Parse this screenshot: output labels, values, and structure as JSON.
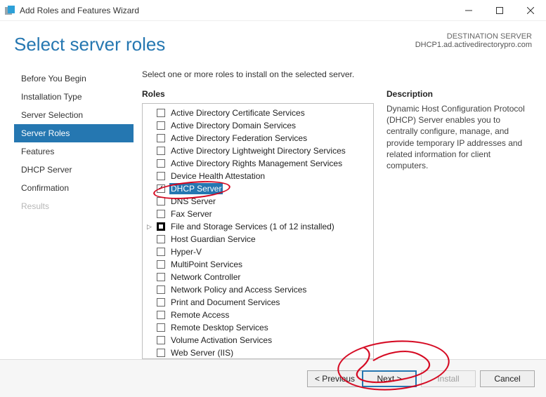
{
  "window": {
    "title": "Add Roles and Features Wizard"
  },
  "header": {
    "page_title": "Select server roles",
    "dest_label": "DESTINATION SERVER",
    "dest_value": "DHCP1.ad.activedirectorypro.com"
  },
  "steps": [
    {
      "label": "Before You Begin",
      "state": "normal"
    },
    {
      "label": "Installation Type",
      "state": "normal"
    },
    {
      "label": "Server Selection",
      "state": "normal"
    },
    {
      "label": "Server Roles",
      "state": "active"
    },
    {
      "label": "Features",
      "state": "normal"
    },
    {
      "label": "DHCP Server",
      "state": "normal"
    },
    {
      "label": "Confirmation",
      "state": "normal"
    },
    {
      "label": "Results",
      "state": "disabled"
    }
  ],
  "instruction": "Select one or more roles to install on the selected server.",
  "roles_label": "Roles",
  "roles": [
    {
      "label": "Active Directory Certificate Services",
      "check": "unchecked"
    },
    {
      "label": "Active Directory Domain Services",
      "check": "unchecked"
    },
    {
      "label": "Active Directory Federation Services",
      "check": "unchecked"
    },
    {
      "label": "Active Directory Lightweight Directory Services",
      "check": "unchecked"
    },
    {
      "label": "Active Directory Rights Management Services",
      "check": "unchecked"
    },
    {
      "label": "Device Health Attestation",
      "check": "unchecked"
    },
    {
      "label": "DHCP Server",
      "check": "checked",
      "selected": true
    },
    {
      "label": "DNS Server",
      "check": "unchecked"
    },
    {
      "label": "Fax Server",
      "check": "unchecked"
    },
    {
      "label": "File and Storage Services (1 of 12 installed)",
      "check": "partial",
      "expandable": true
    },
    {
      "label": "Host Guardian Service",
      "check": "unchecked"
    },
    {
      "label": "Hyper-V",
      "check": "unchecked"
    },
    {
      "label": "MultiPoint Services",
      "check": "unchecked"
    },
    {
      "label": "Network Controller",
      "check": "unchecked"
    },
    {
      "label": "Network Policy and Access Services",
      "check": "unchecked"
    },
    {
      "label": "Print and Document Services",
      "check": "unchecked"
    },
    {
      "label": "Remote Access",
      "check": "unchecked"
    },
    {
      "label": "Remote Desktop Services",
      "check": "unchecked"
    },
    {
      "label": "Volume Activation Services",
      "check": "unchecked"
    },
    {
      "label": "Web Server (IIS)",
      "check": "unchecked"
    }
  ],
  "description": {
    "label": "Description",
    "text": "Dynamic Host Configuration Protocol (DHCP) Server enables you to centrally configure, manage, and provide temporary IP addresses and related information for client computers."
  },
  "buttons": {
    "previous": "< Previous",
    "next": "Next >",
    "install": "Install",
    "cancel": "Cancel"
  }
}
